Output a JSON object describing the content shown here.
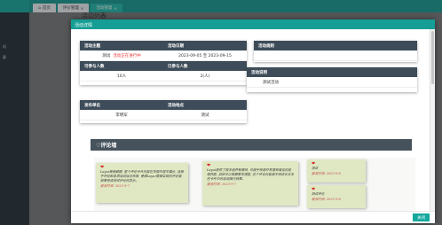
{
  "app": {
    "sidebar_items": [
      "机",
      "客"
    ],
    "tabs": [
      {
        "label": "首页",
        "icon": "home-icon"
      },
      {
        "label": "评价管理",
        "close": "×"
      },
      {
        "label": "活动管理",
        "close": "×"
      }
    ],
    "bg_title": "活动列表"
  },
  "modal": {
    "title": "活动详情",
    "close_button": "关闭",
    "info_card": {
      "headers_row1": [
        "活动主题",
        "活动日期"
      ],
      "topic": "测试",
      "status": "活动正在进行中",
      "date": "2023-09-05 至 2023-09-15",
      "headers_row2": [
        "可参与人数",
        "已参与人数"
      ],
      "capacity": "10人",
      "joined": "2(人)"
    },
    "unit_card": {
      "headers": [
        "发布单位",
        "活动地点"
      ],
      "unit": "李明军",
      "location": "测试"
    },
    "rules_card": {
      "header": "活动规则",
      "value": ""
    },
    "desc_card": {
      "header": "活动说明",
      "value": "测试活动"
    },
    "comments_title": "♡评论墙",
    "comments": [
      {
        "text": "Layui使用截图: 整个评论卡片内容在页面中居中展示, 适用于评论和各项活动信息布局, 使用Layui框架实现的评论墙效果完成测试评论的显示。",
        "time": "留言时间: 2023-9-7"
      },
      {
        "text": "Layui提供了很多组件和模块, 可用于快速开发漂亮简洁的前端界面, 具体可以根据需求调整, 这个评论内容用于测试长文本在卡片中的自动换行效果。",
        "time": "留言时间: 2023-9-7"
      },
      {
        "text": "测试",
        "time": "留言时间: 2023-9-6"
      },
      {
        "text": "测试评论",
        "time": "留言时间: 2023-9-6"
      }
    ]
  }
}
